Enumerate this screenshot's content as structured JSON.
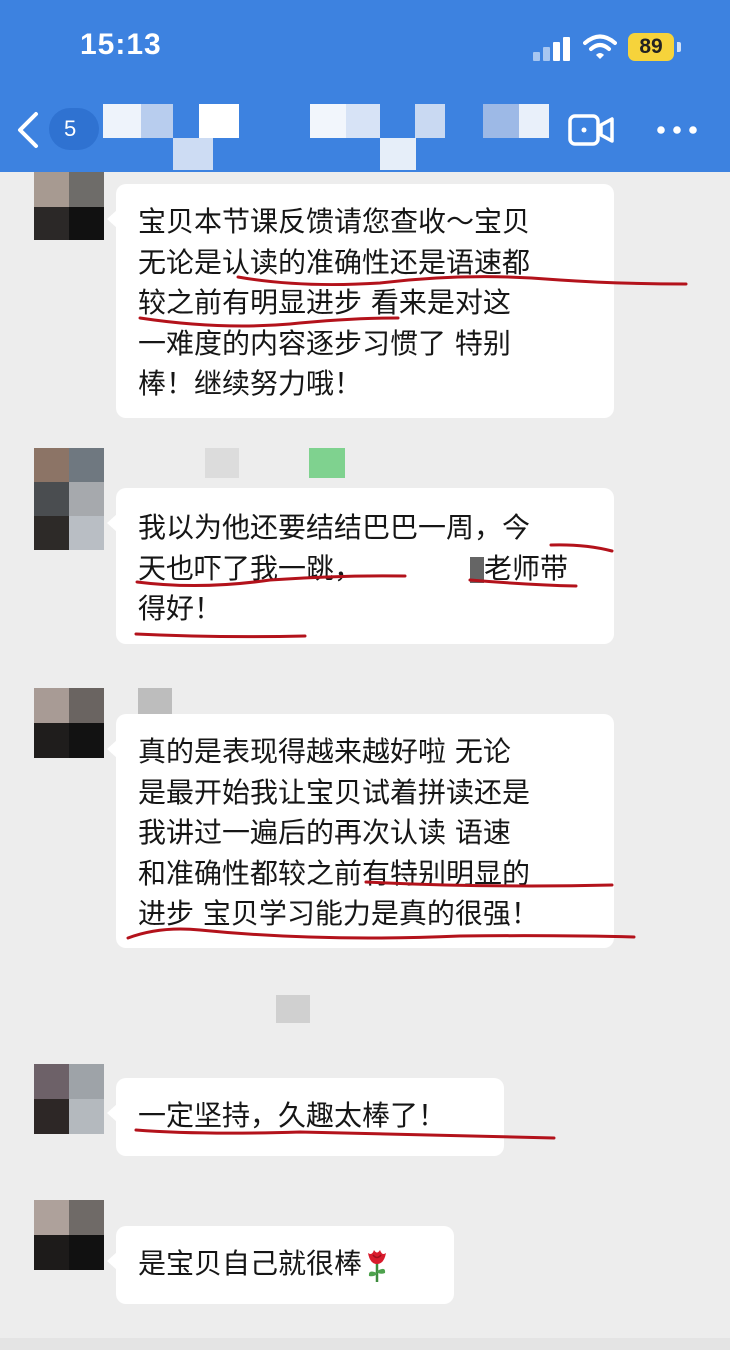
{
  "status_bar": {
    "time": "15:13",
    "battery": "89"
  },
  "nav": {
    "unread_count": "5",
    "back_icon": "chevron-left-icon",
    "video_icon": "video-call-icon",
    "more_icon": "more-dots-icon"
  },
  "colors": {
    "header": "#3d82e0",
    "background": "#ededed",
    "bubble": "#ffffff",
    "ink_underline": "#b3121b",
    "battery": "#f6d33b"
  },
  "messages": [
    {
      "lines": [
        "宝贝本节课反馈请您查收～宝贝",
        "无论是认读的准确性还是语速都",
        "较之前有明显进步 看来是对这",
        "一难度的内容逐步习惯了 特别",
        "棒！继续努力哦！"
      ]
    },
    {
      "lines": [
        "我以为他还要结结巴巴一周，今",
        "天也吓了我一跳，",
        "得好！"
      ],
      "line2_tail": "老师带"
    },
    {
      "lines": [
        "真的是表现得越来越好啦 无论",
        "是最开始我让宝贝试着拼读还是",
        "我讲过一遍后的再次认读 语速",
        "和准确性都较之前有特别明显的",
        "进步 宝贝学习能力是真的很强！"
      ]
    },
    {
      "lines": [
        "一定坚持，久趣太棒了！"
      ]
    },
    {
      "lines": [
        "是宝贝自己就很棒"
      ],
      "emoji_icon": "rose-icon"
    }
  ]
}
